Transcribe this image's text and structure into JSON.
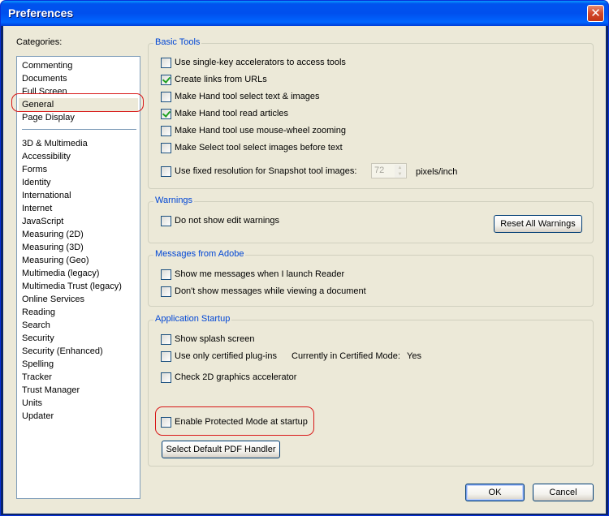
{
  "window": {
    "title": "Preferences",
    "close_glyph": "✕"
  },
  "categories": {
    "label": "Categories:",
    "top_items": [
      "Commenting",
      "Documents",
      "Full Screen",
      "General",
      "Page Display"
    ],
    "items": [
      "3D & Multimedia",
      "Accessibility",
      "Forms",
      "Identity",
      "International",
      "Internet",
      "JavaScript",
      "Measuring (2D)",
      "Measuring (3D)",
      "Measuring (Geo)",
      "Multimedia (legacy)",
      "Multimedia Trust (legacy)",
      "Online Services",
      "Reading",
      "Search",
      "Security",
      "Security (Enhanced)",
      "Spelling",
      "Tracker",
      "Trust Manager",
      "Units",
      "Updater"
    ],
    "selected": "General"
  },
  "basic_tools": {
    "title": "Basic Tools",
    "single_key": {
      "label": "Use single-key accelerators to access tools",
      "checked": false
    },
    "create_links": {
      "label": "Create links from URLs",
      "checked": true
    },
    "hand_select": {
      "label": "Make Hand tool select text & images",
      "checked": false
    },
    "hand_read": {
      "label": "Make Hand tool read articles",
      "checked": true
    },
    "hand_wheel": {
      "label": "Make Hand tool use mouse-wheel zooming",
      "checked": false
    },
    "select_images": {
      "label": "Make Select tool select images before text",
      "checked": false
    },
    "fixed_res": {
      "label": "Use fixed resolution for Snapshot tool images:",
      "checked": false
    },
    "resolution_value": "72",
    "resolution_unit": "pixels/inch"
  },
  "warnings": {
    "title": "Warnings",
    "no_edit": {
      "label": "Do not show edit warnings",
      "checked": false
    },
    "reset_label": "Reset All Warnings"
  },
  "messages": {
    "title": "Messages from Adobe",
    "on_launch": {
      "label": "Show me messages when I launch Reader",
      "checked": false
    },
    "while_viewing": {
      "label": "Don't show messages while viewing a document",
      "checked": false
    }
  },
  "startup": {
    "title": "Application Startup",
    "splash": {
      "label": "Show splash screen",
      "checked": false
    },
    "certified": {
      "label": "Use only certified plug-ins",
      "checked": false
    },
    "certified_mode_label": "Currently in Certified Mode:",
    "certified_mode_value": "Yes",
    "gpu": {
      "label": "Check 2D graphics accelerator",
      "checked": false
    },
    "protected": {
      "label": "Enable Protected Mode at startup",
      "checked": false
    },
    "default_pdf_label": "Select Default PDF Handler"
  },
  "footer": {
    "ok_label": "OK",
    "cancel_label": "Cancel"
  },
  "colors": {
    "title_bar": "#0053ee",
    "group_title": "#0046d5",
    "highlight_ring": "#d81818",
    "dialog_bg": "#ece9d8"
  }
}
